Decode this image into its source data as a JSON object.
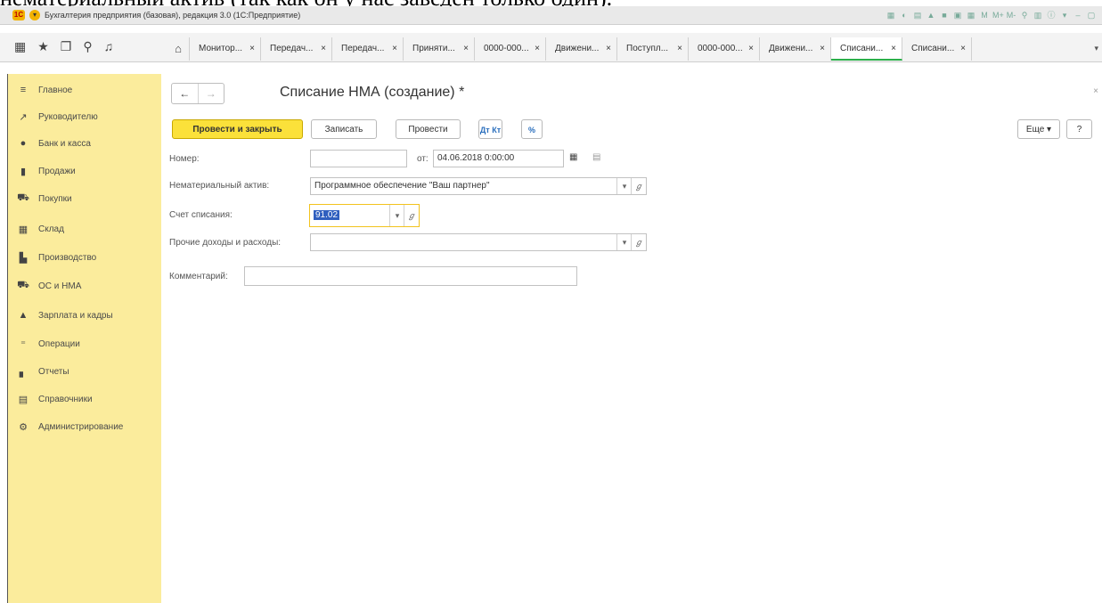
{
  "caption": "нематериальный актив (так как он у нас заведен только один).",
  "titlebar": {
    "logo": "1С",
    "title": "Бухгалтерия предприятия (базовая), редакция 3.0  (1С:Предприятие)",
    "icons": [
      "▦",
      "◐",
      "▤",
      "▲",
      "■",
      "▣",
      "▦",
      "M",
      "M+",
      "M-",
      "⚲",
      "▥",
      "ⓘ",
      "▾",
      "–",
      "▢"
    ]
  },
  "tabbar": {
    "icons": [
      "grid-icon",
      "star-icon",
      "history-icon",
      "search-icon",
      "bell-icon"
    ],
    "home": "⌂",
    "tabs": [
      {
        "label": "Монитор..."
      },
      {
        "label": "Передач..."
      },
      {
        "label": "Передач..."
      },
      {
        "label": "Приняти..."
      },
      {
        "label": "0000-000..."
      },
      {
        "label": "Движени..."
      },
      {
        "label": "Поступл..."
      },
      {
        "label": "0000-000..."
      },
      {
        "label": "Движени..."
      },
      {
        "label": "Списани...",
        "active": true
      },
      {
        "label": "Списани..."
      }
    ],
    "close": "×",
    "more": "▾"
  },
  "sidebar": {
    "items": [
      {
        "label": "Главное",
        "icon": "≡"
      },
      {
        "label": "Руководителю",
        "icon": "↗"
      },
      {
        "label": "Банк и касса",
        "icon": "●"
      },
      {
        "label": "Продажи",
        "icon": "▮"
      },
      {
        "label": "Покупки",
        "icon": "⛟"
      },
      {
        "label": "Склад",
        "icon": "▦"
      },
      {
        "label": "Производство",
        "icon": "▙"
      },
      {
        "label": "ОС и НМА",
        "icon": "⛟"
      },
      {
        "label": "Зарплата и кадры",
        "icon": "▲"
      },
      {
        "label": "Операции",
        "icon": "⁼"
      },
      {
        "label": "Отчеты",
        "icon": "▖"
      },
      {
        "label": "Справочники",
        "icon": "▤"
      },
      {
        "label": "Администрирование",
        "icon": "⚙"
      }
    ]
  },
  "form": {
    "back": "←",
    "forward": "→",
    "title": "Списание НМА (создание) *",
    "close": "×",
    "buttons": {
      "post_close": "Провести и закрыть",
      "save": "Записать",
      "post": "Провести",
      "dtkt": "Дт Кт",
      "percent": "%",
      "more": "Еще ▾",
      "help": "?"
    },
    "number_label": "Номер:",
    "number_value": "",
    "date_prefix": "от:",
    "date_value": "04.06.2018  0:00:00",
    "asset_label": "Нематериальный актив:",
    "asset_value": "Программное обеспечение  \"Ваш партнер\"",
    "account_label": "Счет списания:",
    "account_value": "91.02",
    "other_label": "Прочие доходы и расходы:",
    "other_value": "",
    "comment_label": "Комментарий:",
    "comment_value": "",
    "select_glyph": "▾",
    "link_glyph": "ℊ",
    "calendar_glyph": "▦"
  }
}
